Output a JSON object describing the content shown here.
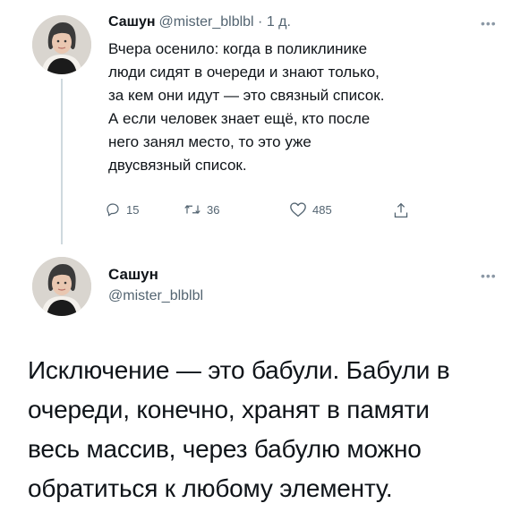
{
  "thread_tweet": {
    "author_name": "Сашун",
    "meta": "@mister_blblbl · 1 д.",
    "text_lines": [
      "Вчера осенило: когда в поликлинике",
      "люди сидят в очереди и знают только,",
      "за кем они идут — это связный список.",
      "А если человек знает ещё, кто после",
      "него занял место, то это уже",
      "двусвязный список."
    ],
    "reply_count": "15",
    "retweet_count": "36",
    "like_count": "485",
    "more_icon": "more-horizontal-icon"
  },
  "main_tweet": {
    "author_name": "Сашун",
    "handle": "@mister_blblbl",
    "text_lines": [
      "Исключение — это бабули. Бабули в",
      "очереди, конечно, хранят в памяти",
      "весь массив, через бабулю можно",
      "обратиться к любому элементу."
    ],
    "more_icon": "more-horizontal-icon"
  },
  "colors": {
    "primary_text": "#0f1419",
    "secondary_text": "#536471",
    "thread_line": "#cfd9de"
  }
}
